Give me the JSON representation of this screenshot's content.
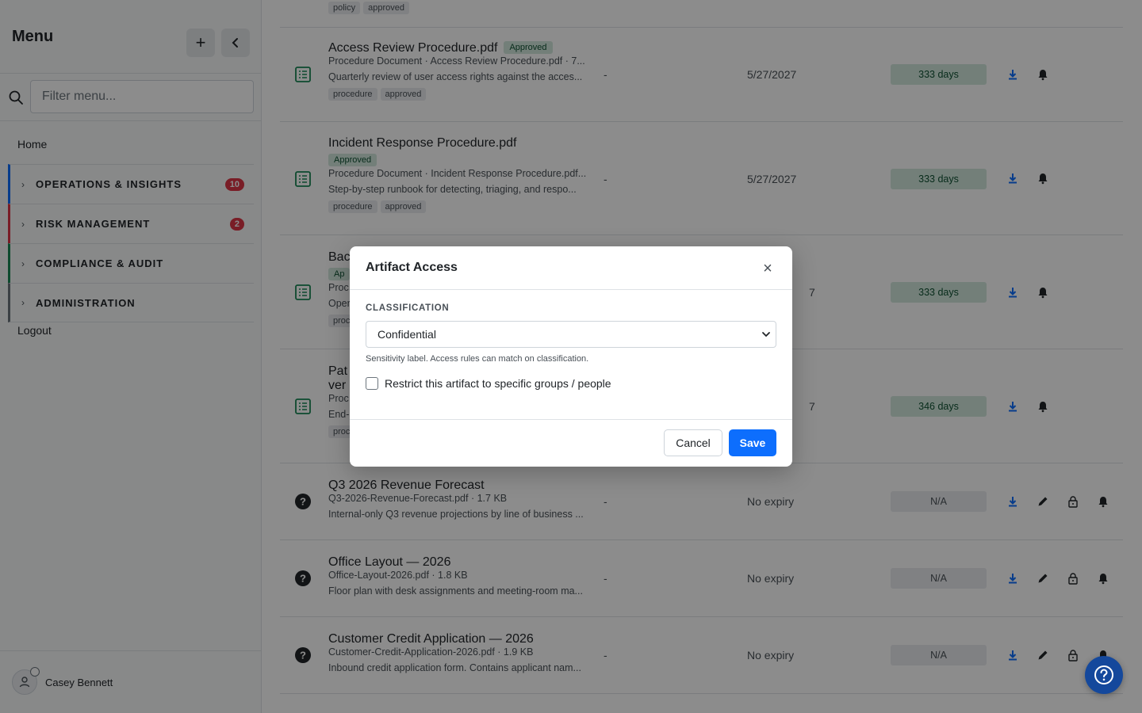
{
  "sidebar": {
    "title": "Menu",
    "add_label": "+",
    "collapse_label": "‹",
    "filter_placeholder": "Filter menu...",
    "home": "Home",
    "sections": [
      {
        "label": "OPERATIONS & INSIGHTS",
        "badge": "10",
        "accent": "#0d6efd"
      },
      {
        "label": "RISK MANAGEMENT",
        "badge": "2",
        "accent": "#dc3545"
      },
      {
        "label": "COMPLIANCE & AUDIT",
        "badge": "",
        "accent": "#198754"
      },
      {
        "label": "ADMINISTRATION",
        "badge": "",
        "accent": "#6c757d"
      }
    ],
    "logout": "Logout",
    "user_name": "Casey Bennett"
  },
  "list": {
    "top_tags": [
      "policy",
      "approved"
    ],
    "rows": [
      {
        "name": "Access Review Procedure.pdf",
        "status": "Approved",
        "meta": "Procedure Document · Access Review Procedure.pdf · 7...",
        "desc": "Quarterly review of user access rights against the acces...",
        "tags": [
          "procedure",
          "approved"
        ],
        "dash": "-",
        "expiry": "5/27/2027",
        "days": "333 days"
      },
      {
        "name": "Incident Response Procedure.pdf",
        "status": "Approved",
        "meta": "Procedure Document · Incident Response Procedure.pdf...",
        "desc": "Step-by-step runbook for detecting, triaging, and respo...",
        "tags": [
          "procedure",
          "approved"
        ],
        "dash": "-",
        "expiry": "5/27/2027",
        "days": "333 days"
      },
      {
        "name": "Bac",
        "status": "Ap",
        "meta": "Proc",
        "desc": "Oper",
        "tags": [
          "proc"
        ],
        "dash": "",
        "expiry": "7",
        "days": "333 days"
      },
      {
        "name": "Pat",
        "name2": "ver",
        "meta": "Proc",
        "desc": "End-",
        "tags": [
          "proc"
        ],
        "dash": "",
        "expiry": "7",
        "days": "346 days"
      },
      {
        "name": "Q3 2026 Revenue Forecast",
        "meta": "Q3-2026-Revenue-Forecast.pdf · 1.7 KB",
        "desc": "Internal-only Q3 revenue projections by line of business ...",
        "dash": "-",
        "expiry": "No expiry",
        "days": "N/A"
      },
      {
        "name": "Office Layout — 2026",
        "meta": "Office-Layout-2026.pdf · 1.8 KB",
        "desc": "Floor plan with desk assignments and meeting-room ma...",
        "dash": "-",
        "expiry": "No expiry",
        "days": "N/A"
      },
      {
        "name": "Customer Credit Application — 2026",
        "meta": "Customer-Credit-Application-2026.pdf · 1.9 KB",
        "desc": "Inbound credit application form. Contains applicant nam...",
        "dash": "-",
        "expiry": "No expiry",
        "days": "N/A"
      }
    ]
  },
  "modal": {
    "title": "Artifact Access",
    "close_label": "×",
    "classification_label": "CLASSIFICATION",
    "classification_value": "Confidential",
    "help_text": "Sensitivity label. Access rules can match on classification.",
    "restrict_label": "Restrict this artifact to specific groups / people",
    "cancel_label": "Cancel",
    "save_label": "Save"
  },
  "colors": {
    "primary": "#0d6efd",
    "success_bg": "#d1e7dd",
    "success_text": "#0f5132",
    "danger": "#dc3545",
    "doc_icon": "#198754"
  }
}
